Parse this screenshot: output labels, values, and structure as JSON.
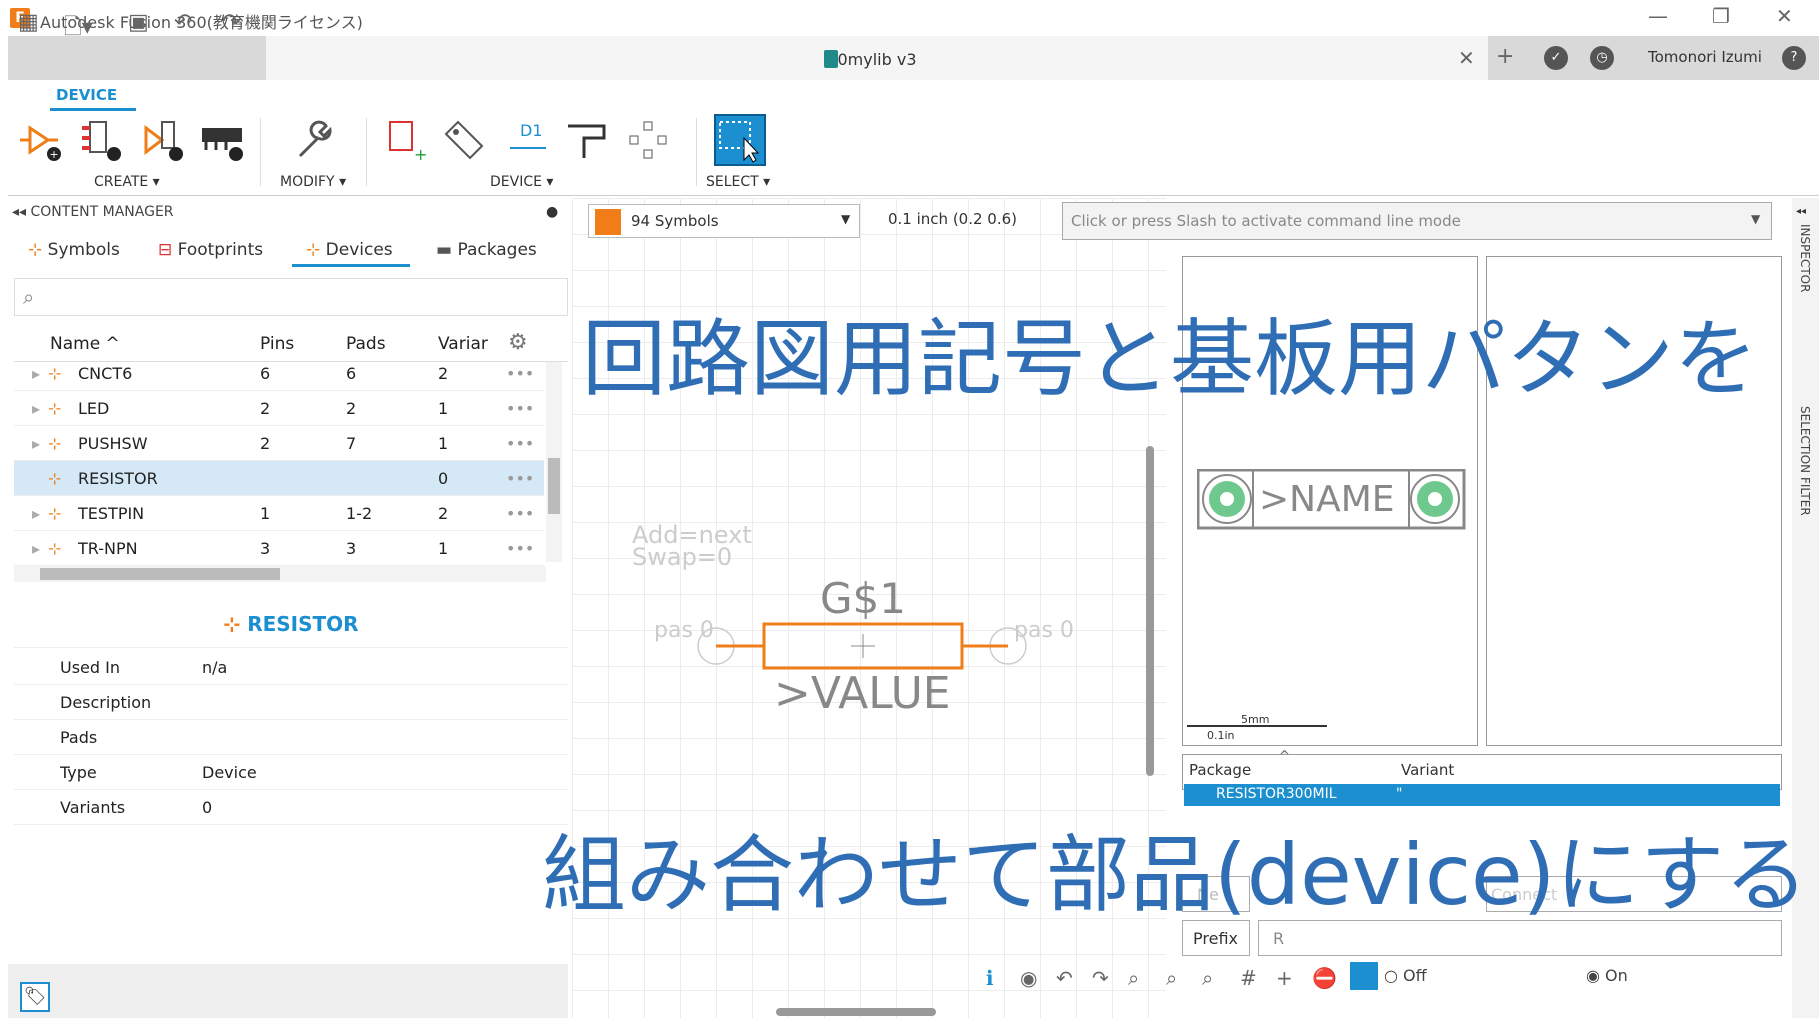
{
  "app": {
    "title": "Autodesk Fusion 360(教育機関ライセンス)",
    "icon": "F"
  },
  "tab": {
    "doc_title": "0mylib v3",
    "user": "Tomonori Izumi"
  },
  "ribbon": {
    "active_tab": "DEVICE",
    "groups": [
      "CREATE ▾",
      "MODIFY ▾",
      "DEVICE ▾",
      "SELECT ▾"
    ],
    "device_icon_label": "D1"
  },
  "content_manager": {
    "title": "CONTENT MANAGER",
    "tabs": [
      "Symbols",
      "Footprints",
      "Devices",
      "Packages"
    ],
    "columns": [
      "Name ^",
      "Pins",
      "Pads",
      "Variar"
    ],
    "rows": [
      {
        "name": "CNCT6",
        "pins": "6",
        "pads": "6",
        "variants": "2"
      },
      {
        "name": "LED",
        "pins": "2",
        "pads": "2",
        "variants": "1"
      },
      {
        "name": "PUSHSW",
        "pins": "2",
        "pads": "7",
        "variants": "1"
      },
      {
        "name": "RESISTOR",
        "pins": "",
        "pads": "",
        "variants": "0"
      },
      {
        "name": "TESTPIN",
        "pins": "1",
        "pads": "1-2",
        "variants": "2"
      },
      {
        "name": "TR-NPN",
        "pins": "3",
        "pads": "3",
        "variants": "1"
      }
    ],
    "row_menu": "•••"
  },
  "detail": {
    "title": "RESISTOR",
    "rows": [
      {
        "label": "Used In",
        "value": "n/a"
      },
      {
        "label": "Description",
        "value": ""
      },
      {
        "label": "Pads",
        "value": ""
      },
      {
        "label": "Type",
        "value": "Device"
      },
      {
        "label": "Variants",
        "value": "0"
      }
    ]
  },
  "editor": {
    "symbol_count": "94 Symbols",
    "grid": "0.1 inch (0.2 0.6)",
    "cmd_placeholder": "Click or press Slash to activate command line mode",
    "add_text": "Add=next",
    "swap_text": "Swap=0",
    "gate_name": ">VALUE",
    "gate_label": "G$1",
    "pin_left": "pas 0",
    "pin_right": "pas 0"
  },
  "package": {
    "name_text": ">NAME",
    "scale_mm": "5mm",
    "scale_in": "0.1in",
    "col_package": "Package",
    "col_variant": "Variant",
    "row_package": "RESISTOR300MIL",
    "row_variant": "\"",
    "prefix_label": "Prefix",
    "prefix_value": "R",
    "name_label": "Ne",
    "connect_label": "Connect"
  },
  "bottom": {
    "off_label": "Off",
    "on_label": "On"
  },
  "side": {
    "inspector": "INSPECTOR",
    "selection_filter": "SELECTION FILTER"
  },
  "overlay": {
    "line1": "回路図用記号と基板用パタンを",
    "line2": "組み合わせて部品(device)にする"
  },
  "colors": {
    "accent": "#1c8fd1",
    "symbol_orange": "#f07d17",
    "overlay_blue": "#2f6eb5"
  }
}
